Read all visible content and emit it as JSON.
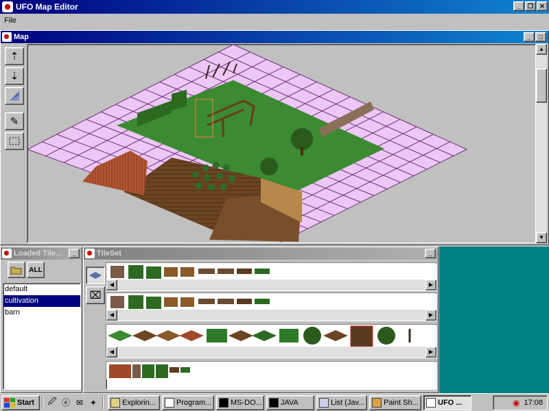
{
  "app": {
    "title": "UFO Map Editor"
  },
  "menu": {
    "file": "File"
  },
  "map_frame": {
    "title": "Map"
  },
  "loaded_frame": {
    "title": "Loaded Tile...",
    "all_label": "ALL",
    "items": [
      "default",
      "cultivation",
      "barn"
    ],
    "selected": 1
  },
  "tileset_frame": {
    "title": "TileSet"
  },
  "taskbar": {
    "start": "Start",
    "tasks": [
      "Explorin...",
      "Program...",
      "MS-DO...",
      "JAVA",
      "List (Jav...",
      "Paint Sh...",
      "UFO ..."
    ],
    "active_index": 6,
    "clock": "17:08"
  },
  "colors": {
    "grid_fill": "#ebc8f5",
    "grid_line": "#6e2a78",
    "grass": "#3c8a32",
    "soil": "#6b4424",
    "desktop": "#008080",
    "titlebar": "#000080"
  },
  "icons": [
    "app-icon",
    "raise-level-icon",
    "lower-level-icon",
    "view-level-icon",
    "brush-icon",
    "select-rect-icon",
    "open-folder-icon",
    "load-all-icon",
    "floor-view-icon",
    "wall-view-icon"
  ]
}
